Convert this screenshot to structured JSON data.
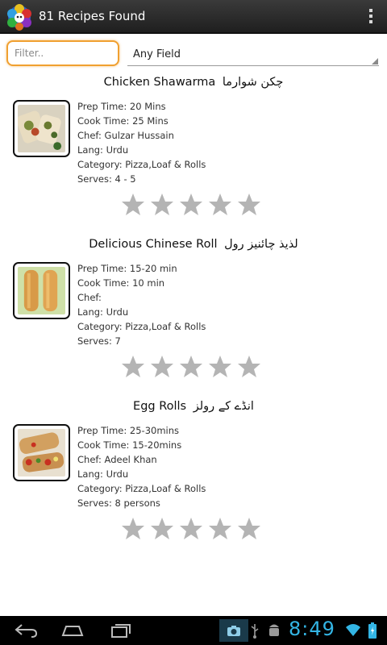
{
  "app": {
    "title": "81 Recipes Found",
    "logo_icon": "rainbow-globe-icon",
    "overflow_icon": "overflow-menu-icon"
  },
  "filter": {
    "placeholder": "Filter..",
    "value": "",
    "field_selected": "Any Field"
  },
  "recipes": [
    {
      "title_en": "Chicken Shawarma",
      "title_ur": "چکن شوارما",
      "prep": "Prep Time: 20 Mins",
      "cook": "Cook Time: 25 Mins",
      "chef": "Chef: Gulzar Hussain",
      "lang": "Lang: Urdu",
      "category": "Category: Pizza,Loaf & Rolls",
      "serves": "Serves: 4 - 5",
      "rating": 0,
      "thumb_icon": "shawarma-photo"
    },
    {
      "title_en": "Delicious Chinese Roll",
      "title_ur": "لذیذ چائنیز رول",
      "prep": "Prep Time: 15-20 min",
      "cook": "Cook Time: 10 min",
      "chef": "Chef:",
      "lang": "Lang: Urdu",
      "category": "Category: Pizza,Loaf & Rolls",
      "serves": "Serves: 7",
      "rating": 0,
      "thumb_icon": "chinese-roll-photo"
    },
    {
      "title_en": "Egg Rolls",
      "title_ur": "انڈے کے رولز",
      "prep": "Prep Time: 25-30mins",
      "cook": "Cook Time: 15-20mins",
      "chef": "Chef: Adeel Khan",
      "lang": "Lang: Urdu",
      "category": "Category: Pizza,Loaf & Rolls",
      "serves": "Serves: 8 persons",
      "rating": 0,
      "thumb_icon": "egg-roll-photo"
    }
  ],
  "system": {
    "time": "8:49",
    "nav": [
      "back-icon",
      "home-icon",
      "recent-apps-icon"
    ],
    "status_icons": [
      "camera-icon",
      "usb-icon",
      "android-debug-icon",
      "wifi-icon",
      "battery-icon"
    ],
    "accent": "#33b5e5",
    "focus": "#f0a030",
    "star_color": "#b4b4b4"
  }
}
